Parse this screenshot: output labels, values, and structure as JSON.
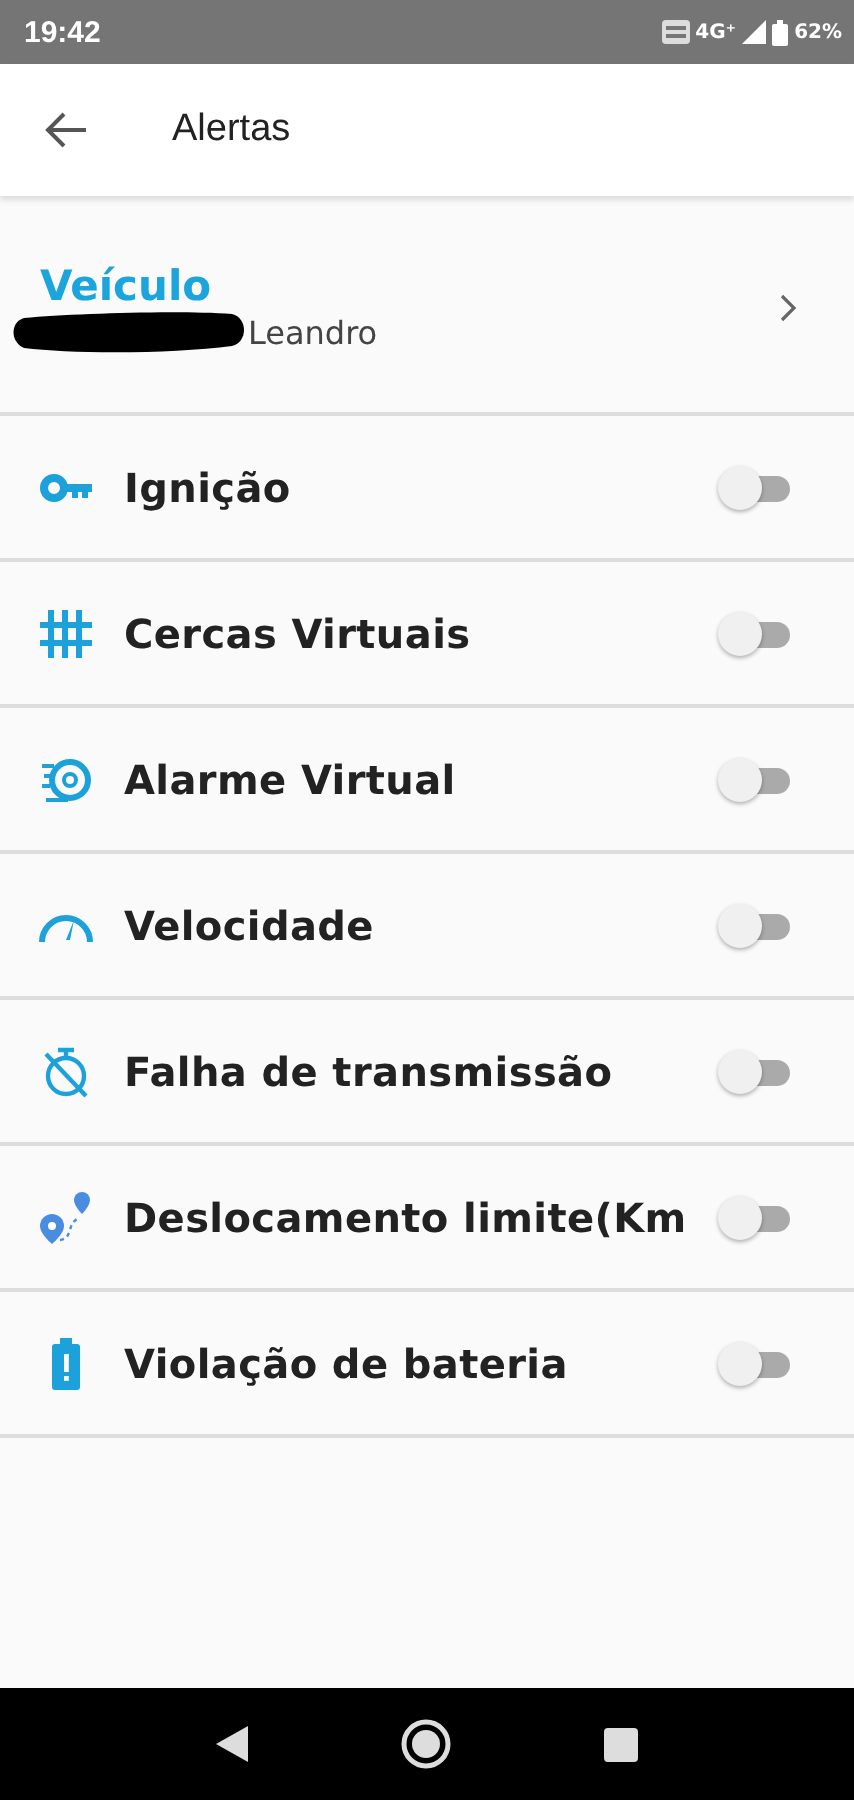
{
  "status_bar": {
    "time": "19:42",
    "network": "4G⁺",
    "battery": "62%"
  },
  "app_bar": {
    "title": "Alertas"
  },
  "vehicle": {
    "heading": "Veículo",
    "name": "Leandro"
  },
  "alerts": [
    {
      "label": "Ignição",
      "on": false
    },
    {
      "label": "Cercas Virtuais",
      "on": false
    },
    {
      "label": "Alarme Virtual",
      "on": false
    },
    {
      "label": "Velocidade",
      "on": false
    },
    {
      "label": "Falha de transmissão",
      "on": false
    },
    {
      "label": "Deslocamento limite(Km",
      "on": false
    },
    {
      "label": "Violação de bateria",
      "on": false
    }
  ]
}
